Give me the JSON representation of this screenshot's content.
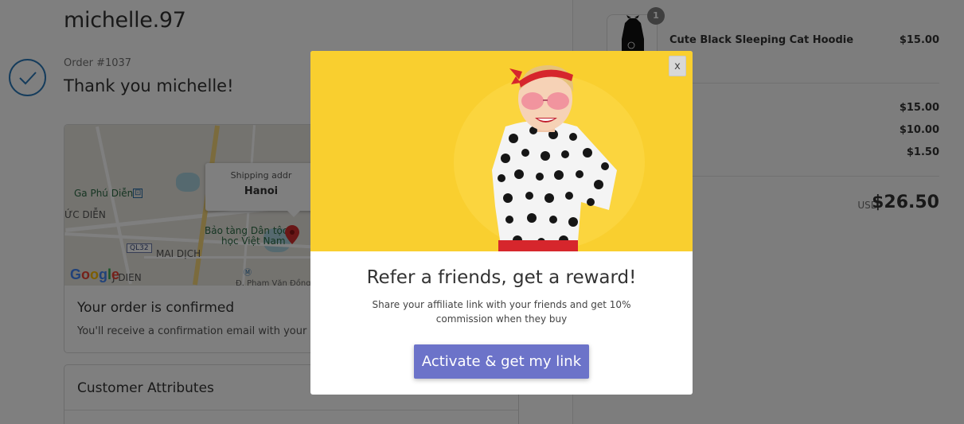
{
  "shop": {
    "name": "michelle.97"
  },
  "order": {
    "number": "Order #1037",
    "thank_you": "Thank you michelle!",
    "check_icon": "checkmark-icon"
  },
  "map": {
    "tooltip_label": "Shipping addr",
    "tooltip_city": "Hanoi",
    "labels": {
      "ga_phu_dien": "Ga Phú Diễn",
      "uc_dien": "ỨC DIỄN",
      "museum_line1": "Bảo tàng Dân tộc",
      "museum_line2": "học Việt Nam",
      "mai_dich": "MAI DỊCH",
      "dien": "J DIEN",
      "ql32": "QL32",
      "street": "Đ. Phạm Văn Đồng"
    },
    "google": {
      "G": "G",
      "o1": "o",
      "o2": "o",
      "g": "g",
      "l": "l",
      "e": "e"
    },
    "pin_icon": "map-pin-icon"
  },
  "confirmation": {
    "title": "Your order is confirmed",
    "text": "You'll receive a confirmation email with your ord"
  },
  "attributes": {
    "title": "Customer Attributes"
  },
  "cart": {
    "item": {
      "name": "Cute Black Sleeping Cat Hoodie",
      "price": "$15.00",
      "quantity": "1",
      "image_icon": "hoodie-thumbnail"
    },
    "summary_values": [
      "$15.00",
      "$10.00",
      "$1.50"
    ],
    "total_currency": "USD",
    "total": "$26.50"
  },
  "modal": {
    "close_label": "x",
    "title": "Refer a friends, get a reward!",
    "text": "Share your affiliate link with your friends and get 10% commission when they buy",
    "button_label": "Activate & get my link",
    "accent_color": "#6c73c9",
    "hero_color": "#f9cf2f"
  }
}
